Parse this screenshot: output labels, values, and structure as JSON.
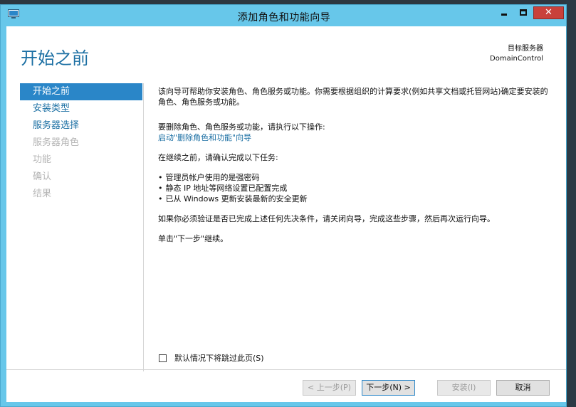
{
  "window": {
    "title": "添加角色和功能向导"
  },
  "header": {
    "page_title": "开始之前",
    "target_label": "目标服务器",
    "target_server": "DomainControl"
  },
  "nav": {
    "items": [
      {
        "label": "开始之前",
        "state": "selected"
      },
      {
        "label": "安装类型",
        "state": "enabled"
      },
      {
        "label": "服务器选择",
        "state": "enabled"
      },
      {
        "label": "服务器角色",
        "state": "disabled"
      },
      {
        "label": "功能",
        "state": "disabled"
      },
      {
        "label": "确认",
        "state": "disabled"
      },
      {
        "label": "结果",
        "state": "disabled"
      }
    ]
  },
  "content": {
    "intro": "该向导可帮助你安装角色、角色服务或功能。你需要根据组织的计算要求(例如共享文档或托管网站)确定要安装的角色、角色服务或功能。",
    "remove_prompt": "要删除角色、角色服务或功能，请执行以下操作:",
    "remove_link": "启动\"删除角色和功能\"向导",
    "verify_prompt": "在继续之前，请确认完成以下任务:",
    "tasks": [
      "管理员帐户使用的是强密码",
      "静态 IP 地址等网络设置已配置完成",
      "已从 Windows 更新安装最新的安全更新"
    ],
    "verify_note": "如果你必须验证是否已完成上述任何先决条件，请关闭向导，完成这些步骤，然后再次运行向导。",
    "continue_note": "单击\"下一步\"继续。"
  },
  "skip": {
    "label": "默认情况下将跳过此页(S)",
    "checked": false
  },
  "buttons": {
    "prev": "< 上一步(P)",
    "next": "下一步(N) >",
    "install": "安装(I)",
    "cancel": "取消"
  },
  "colors": {
    "title_bar": "#67c7ea",
    "accent": "#1b6fa3",
    "selected_nav": "#2a86c8",
    "close_button": "#c9413b"
  }
}
